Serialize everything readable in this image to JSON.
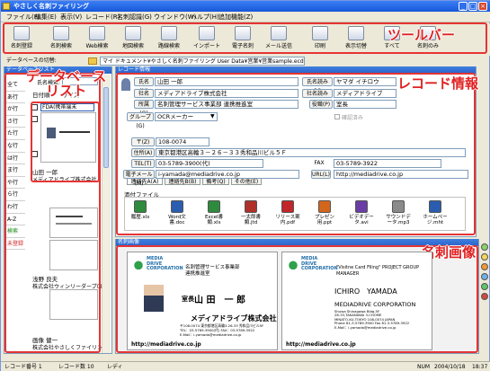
{
  "title": "やさしく名刺ファイリング",
  "menu": [
    "ファイル(F)",
    "編集(E)",
    "表示(V)",
    "レコード(R)",
    "名刺認識(G)",
    "ウインドウ(W)",
    "ヘルプ(H)",
    "追加機能(Z)"
  ],
  "toolbar": [
    {
      "label": "名刺登録",
      "icon": "register-card-icon"
    },
    {
      "label": "名刺検索",
      "icon": "search-card-icon"
    },
    {
      "label": "Web検索",
      "icon": "web-search-icon"
    },
    {
      "label": "地図検索",
      "icon": "map-search-icon"
    },
    {
      "label": "路線検索",
      "icon": "train-route-icon"
    },
    {
      "label": "インポート",
      "icon": "import-icon"
    },
    {
      "label": "電子名刺",
      "icon": "e-card-icon"
    },
    {
      "label": "メール送信",
      "icon": "mail-icon"
    },
    {
      "label": "印刷",
      "icon": "print-icon"
    },
    {
      "label": "表示切替",
      "icon": "view-switch-icon"
    },
    {
      "label": "すべて",
      "icon": "all-icon"
    },
    {
      "label": "名刺のみ",
      "icon": "card-only-icon"
    }
  ],
  "annotations": {
    "toolbar": "ツールバー",
    "list": "データベース\nリスト",
    "record": "レコード情報",
    "image": "名刺画像"
  },
  "path": {
    "label": "データベースの切替:",
    "value": "マイ ドキュメント¥やさしく名刺ファイリング User Data¥営業¥営業sample.ecd"
  },
  "list_panel": {
    "header": "データベースリスト",
    "search_label": "氏名検索:",
    "col_a": "日付順",
    "col_b": "サイズ",
    "tabs": [
      "全て",
      "あ行",
      "か行",
      "さ行",
      "た行",
      "な行",
      "は行",
      "ま行",
      "や行",
      "ら行",
      "わ行",
      "A-Z",
      "検索",
      "未登録"
    ],
    "cards": [
      {
        "caption": "FDA(携帯端末",
        "name": "山田 一郎",
        "company": "メディアドライブ株式会社"
      },
      {
        "name": "浅野 良夫",
        "company": "株式会社ウィンリーダープロ"
      },
      {
        "name": "画像 健一",
        "company": "株式会社やさしくファイリング"
      }
    ]
  },
  "record": {
    "header": "レコード情報",
    "name_label": "氏名(N)",
    "name_value": "山田 一郎",
    "company_label": "社名(C)",
    "company_value": "メディアドライブ株式会社",
    "dept_label": "所属(O)",
    "dept_value": "名刺管理サービス事業部 連携推進室",
    "group_label": "グループ(G)",
    "group_value": "OCRメーカー",
    "kana_label": "氏名読み(Y)",
    "kana_value": "ヤマダ イチロウ",
    "company_kana_label": "社名読み(U)",
    "company_kana_value": "メディアドライブ",
    "title_label": "役職(P)",
    "title_value": "室長",
    "confirmed": "確認済み",
    "tabs": [
      "連絡先A(A)",
      "連絡先B(B)",
      "備考(Q)",
      "その他(E)"
    ],
    "zip_label": "〒(Z)",
    "zip_value": "108-0074",
    "address_label": "住所(A)",
    "address_value": "東京都港区高輪３－２６－３３秀和品川ビル５Ｆ",
    "tel_label": "TEL(T)",
    "tel_value": "03-5789-3900(代)",
    "fax_label": "FAX",
    "fax_value": "03-5789-3922",
    "mail_label": "電子メール(M)",
    "mail_value": "i-yamada@mediadrive.co.jp",
    "url_label": "URL(L)",
    "url_value": "http://mediadrive.co.jp",
    "files_label": "添付ファイル",
    "files": [
      {
        "label": "履歴.xls",
        "color": "#2e8b3d"
      },
      {
        "label": "Word文書.doc",
        "color": "#2a5db0"
      },
      {
        "label": "Excel書類.xls",
        "color": "#2e8b3d"
      },
      {
        "label": "一太郎書類.jtd",
        "color": "#b0302a"
      },
      {
        "label": "リリース案内.pdf",
        "color": "#c0262a"
      },
      {
        "label": "プレゼン用.ppt",
        "color": "#d2661c"
      },
      {
        "label": "ビデオデータ.avi",
        "color": "#6a3da6"
      },
      {
        "label": "サウンドデータ.mp3",
        "color": "#8a8a8a"
      },
      {
        "label": "ホームページ.mht",
        "color": "#2a5db0"
      }
    ]
  },
  "image_panel": {
    "header": "名刺画像",
    "front": {
      "logo": "MEDIA\nDRIVE\nCORPORATION",
      "dept": "名刺管理サービス事業部\n連携推進室",
      "title": "室長",
      "name": "山 田　一 郎",
      "company": "メディアドライブ株式会社",
      "address": "〒108-0074 東京都港区高輪3-26-33 秀和品川ビル5F",
      "tel": "TEL：03-5789-3900(代) FAX：03-5789-3922",
      "mail": "E-Mail：i-yamada@mediadrive.co.jp",
      "web": "http://mediadrive.co.jp"
    },
    "back": {
      "logo": "MEDIA\nDRIVE\nCORPORATION",
      "project": "\"Visitne Card Filing\" PROJECT GROUP\nMANAGER",
      "name": "ICHIRO　YAMADA",
      "company": "MEDIADRIVE CORPORATION",
      "address": "Shuwa Shinagawa Bldg.5F\n26-33,TAKANAWA 3-CHOME\nMINATO-KU,TOKYO 108-0074 JAPAN\nPhone 81-3-5789-3900 Fax 81-3-5789-3922\nE-Mail：i-yamada@mediadrive.co.jp",
      "web": "http://mediadrive.co.jp"
    }
  },
  "status": {
    "record_no": "レコード番号 1",
    "count": "レコード数 10",
    "ready": "レディ",
    "num": "NUM",
    "date": "2004/10/18",
    "time": "18:37"
  }
}
